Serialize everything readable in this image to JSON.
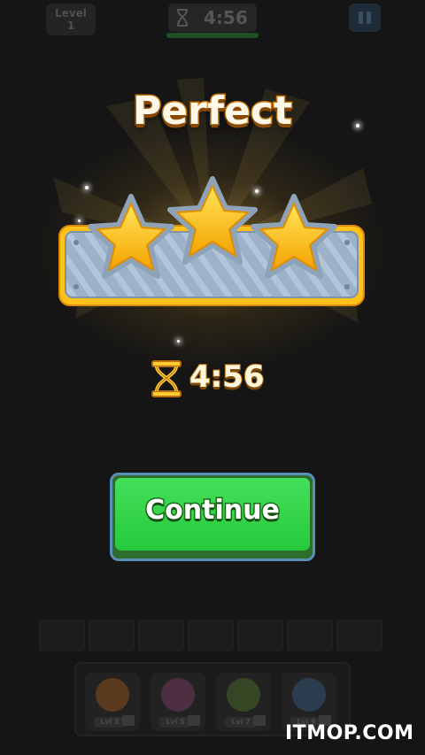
{
  "hud": {
    "level_label": "Level",
    "level_number": "1",
    "timer": "4:56",
    "pause_icon": "pause-icon",
    "timer_icon": "hourglass-icon"
  },
  "result": {
    "title": "Perfect",
    "stars_earned": 3,
    "stars_total": 3,
    "time": "4:56",
    "time_icon": "hourglass-icon"
  },
  "continue_button": {
    "label": "Continue"
  },
  "tray": {
    "slot_count": 7,
    "boosters": [
      {
        "icon": "vacuum-icon",
        "level": "Lvl 5"
      },
      {
        "icon": "stack-icon",
        "level": "Lvl 5"
      },
      {
        "icon": "fan-icon",
        "level": "Lvl 7"
      },
      {
        "icon": "blower-icon",
        "level": "Lvl 9"
      }
    ]
  },
  "watermark": "ITMOP.COM",
  "colors": {
    "background": "#151515",
    "button_green": "#2ed34a",
    "star_gold": "#ffc21a",
    "title_outline": "#c9770c"
  }
}
